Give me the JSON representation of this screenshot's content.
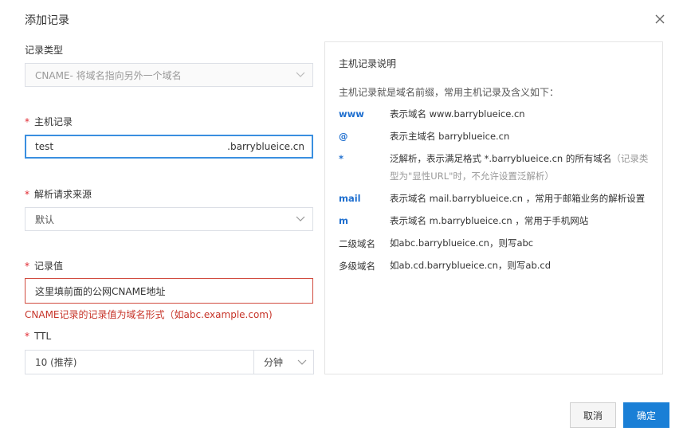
{
  "dialog": {
    "title": "添加记录"
  },
  "form": {
    "record_type": {
      "label": "记录类型",
      "value": "CNAME- 将域名指向另外一个域名"
    },
    "host": {
      "label": "主机记录",
      "value": "test",
      "suffix": ".barryblueice.cn"
    },
    "source": {
      "label": "解析请求来源",
      "value": "默认"
    },
    "record_value": {
      "label": "记录值",
      "placeholder": "这里填前面的公网CNAME地址",
      "error": "CNAME记录的记录值为域名形式（如abc.example.com)"
    },
    "ttl": {
      "label": "TTL",
      "value": "10 (推荐)",
      "unit": "分钟"
    }
  },
  "help": {
    "title": "主机记录说明",
    "intro": "主机记录就是域名前缀，常用主机记录及含义如下：",
    "rows": [
      {
        "key": "www",
        "desc": "表示域名 www.barryblueice.cn"
      },
      {
        "key": "@",
        "desc": "表示主域名 barryblueice.cn"
      },
      {
        "key": "*",
        "desc": "泛解析，表示满足格式 *.barryblueice.cn 的所有域名",
        "note": "（记录类型为\"显性URL\"时，不允许设置泛解析）"
      },
      {
        "key": "mail",
        "desc": "表示域名 mail.barryblueice.cn ，常用于邮箱业务的解析设置"
      },
      {
        "key": "m",
        "desc": "表示域名 m.barryblueice.cn ，常用于手机网站"
      },
      {
        "key": "二级域名",
        "desc": "如abc.barryblueice.cn，则写abc"
      },
      {
        "key": "多级域名",
        "desc": "如ab.cd.barryblueice.cn，则写ab.cd"
      }
    ]
  },
  "footer": {
    "cancel": "取消",
    "ok": "确定"
  },
  "colors": {
    "accent": "#1a7fd6",
    "required": "#e0262f",
    "error": "#c7352a",
    "key_blue": "#1f6fcf"
  }
}
